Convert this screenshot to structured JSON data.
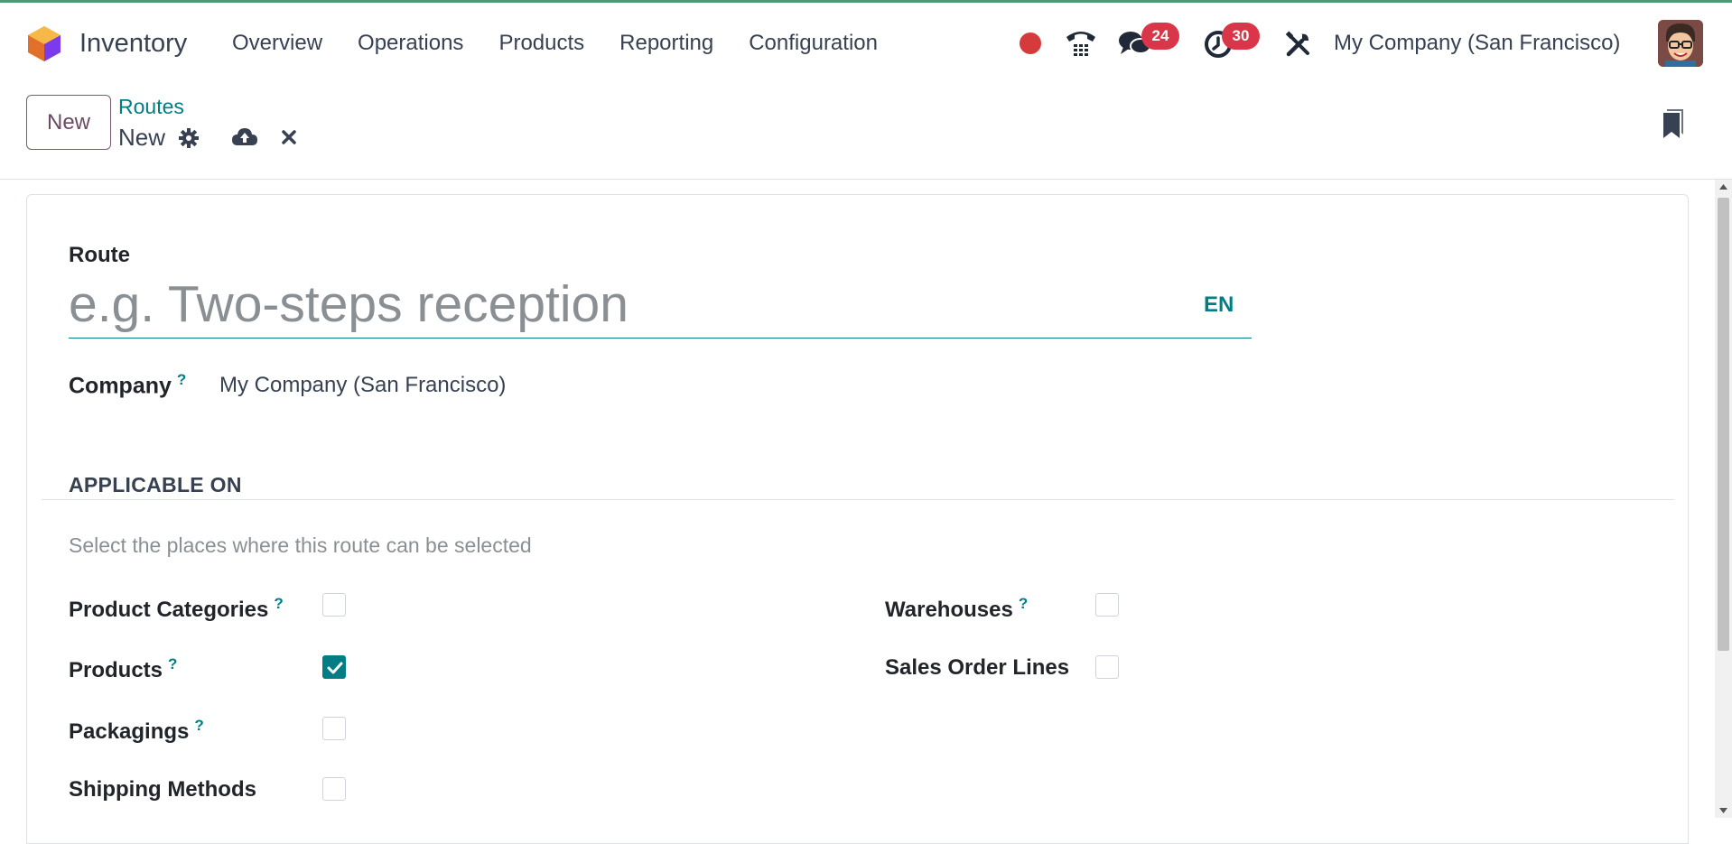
{
  "navbar": {
    "app_name": "Inventory",
    "menu": [
      "Overview",
      "Operations",
      "Products",
      "Reporting",
      "Configuration"
    ],
    "messages_count": "24",
    "activities_count": "30",
    "company": "My Company (San Francisco)"
  },
  "control": {
    "new_label": "New",
    "breadcrumb": "Routes",
    "record_title": "New"
  },
  "form": {
    "route_label": "Route",
    "route_placeholder": "e.g. Two-steps reception",
    "route_value": "",
    "lang": "EN",
    "company_label": "Company",
    "company_value": "My Company (San Francisco)",
    "help_mark": "?",
    "section_title": "APPLICABLE ON",
    "section_hint": "Select the places where this route can be selected",
    "fields_left": [
      {
        "label": "Product Categories",
        "help": true,
        "checked": false
      },
      {
        "label": "Products",
        "help": true,
        "checked": true
      },
      {
        "label": "Packagings",
        "help": true,
        "checked": false
      },
      {
        "label": "Shipping Methods",
        "help": false,
        "checked": false
      }
    ],
    "fields_right": [
      {
        "label": "Warehouses",
        "help": true,
        "checked": false
      },
      {
        "label": "Sales Order Lines",
        "help": false,
        "checked": false
      }
    ]
  },
  "colors": {
    "accent": "#017e84",
    "badge": "#d9364a",
    "record_dot": "#d63b3b"
  }
}
